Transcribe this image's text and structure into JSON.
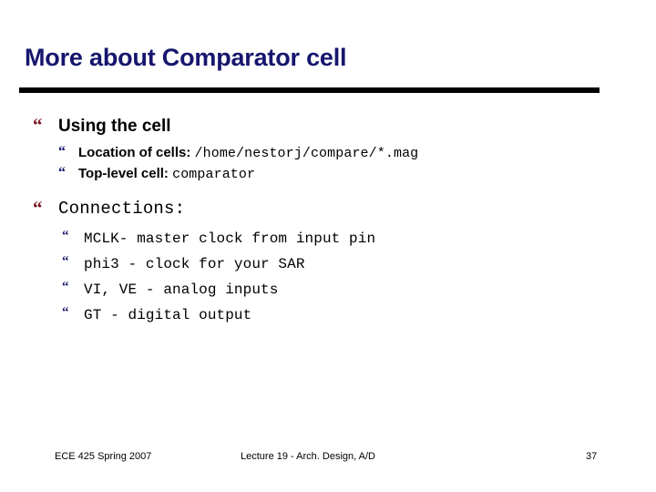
{
  "slide": {
    "title": "More about Comparator cell",
    "title_color": "#16166e",
    "rule_color": "#000000",
    "bullet_level1_glyph": "“",
    "bullet_level1_color": "#7b1320",
    "bullet_level2_glyph": "“",
    "bullet_level2_color": "#16166e",
    "background": "#ffffff"
  },
  "body": {
    "groups": [
      {
        "heading": "Using the cell",
        "heading_style": "sans-bold",
        "items": [
          {
            "label": "Location of cells:",
            "code": "/home/nestorj/compare/*.mag"
          },
          {
            "label": "Top-level cell:",
            "code": "comparator"
          }
        ]
      },
      {
        "heading": "Connections:",
        "heading_style": "mono",
        "items": [
          {
            "text": "MCLK- master clock from input pin"
          },
          {
            "text": "phi3 - clock for your SAR"
          },
          {
            "text": "VI, VE - analog inputs"
          },
          {
            "text": "GT - digital output"
          }
        ]
      }
    ]
  },
  "footer": {
    "left": "ECE 425 Spring 2007",
    "center": "Lecture 19 - Arch. Design, A/D",
    "page": "37"
  }
}
